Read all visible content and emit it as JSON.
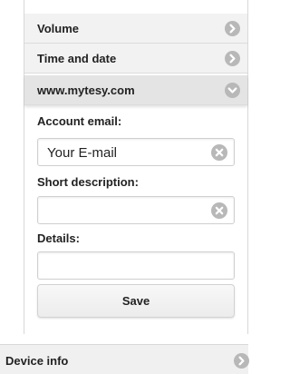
{
  "settings": {
    "sections": [
      {
        "label": "Volume",
        "state": "collapsed",
        "icon": "chevron-right-icon"
      },
      {
        "label": "Time and date",
        "state": "collapsed",
        "icon": "chevron-right-icon"
      },
      {
        "label": "www.mytesy.com",
        "state": "expanded",
        "icon": "chevron-down-icon"
      }
    ],
    "mytesy_form": {
      "email_label": "Account email:",
      "email_value": "Your E-mail",
      "description_label": "Short description:",
      "description_value": "",
      "details_label": "Details:",
      "details_value": "",
      "save_label": "Save"
    },
    "device_info": {
      "label": "Device info",
      "state": "collapsed",
      "icon": "chevron-right-icon"
    }
  },
  "colors": {
    "icon_fill": "#b8b8b8",
    "row_bg": "#f2f2f2",
    "row_open_bg": "#e4e4e4"
  }
}
